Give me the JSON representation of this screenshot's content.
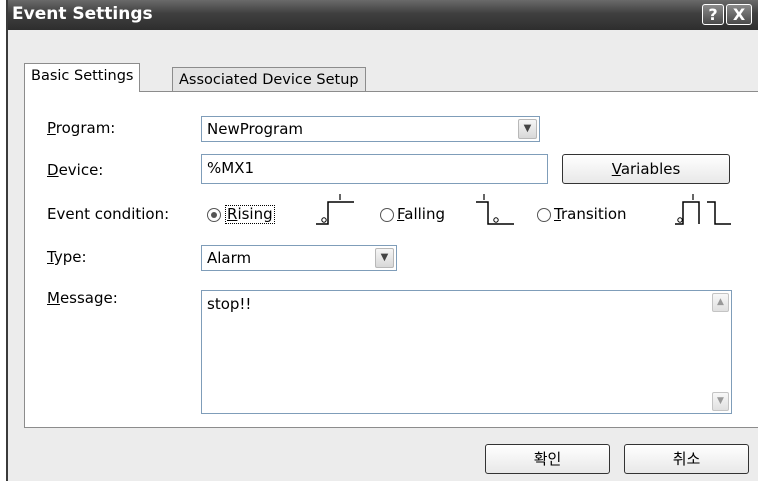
{
  "window": {
    "title": "Event Settings",
    "help_label": "?",
    "close_label": "X"
  },
  "tabs": [
    {
      "label": "Basic Settings",
      "active": true
    },
    {
      "label": "Associated Device Setup",
      "active": false
    }
  ],
  "program": {
    "label_key": "P",
    "label_rest": "rogram:",
    "value": "NewProgram"
  },
  "device": {
    "label_key": "D",
    "label_rest": "evice:",
    "value": "%MX1",
    "variables_key": "V",
    "variables_rest": "ariables"
  },
  "event_condition": {
    "label": "Event condition:",
    "options": [
      {
        "key": "R",
        "rest": "ising",
        "selected": true
      },
      {
        "key": "F",
        "rest": "alling",
        "selected": false
      },
      {
        "key": "T",
        "rest": "ransition",
        "selected": false
      }
    ]
  },
  "type": {
    "label_key": "T",
    "label_rest": "ype:",
    "value": "Alarm"
  },
  "message": {
    "label_key": "M",
    "label_rest": "essage:",
    "value": "stop!!"
  },
  "buttons": {
    "ok": "확인",
    "cancel": "취소"
  },
  "icons": [
    "help-icon",
    "close-icon",
    "chevron-down-icon",
    "rising-edge-icon",
    "falling-edge-icon",
    "transition-edge-icon",
    "scroll-up-icon",
    "scroll-down-icon"
  ]
}
